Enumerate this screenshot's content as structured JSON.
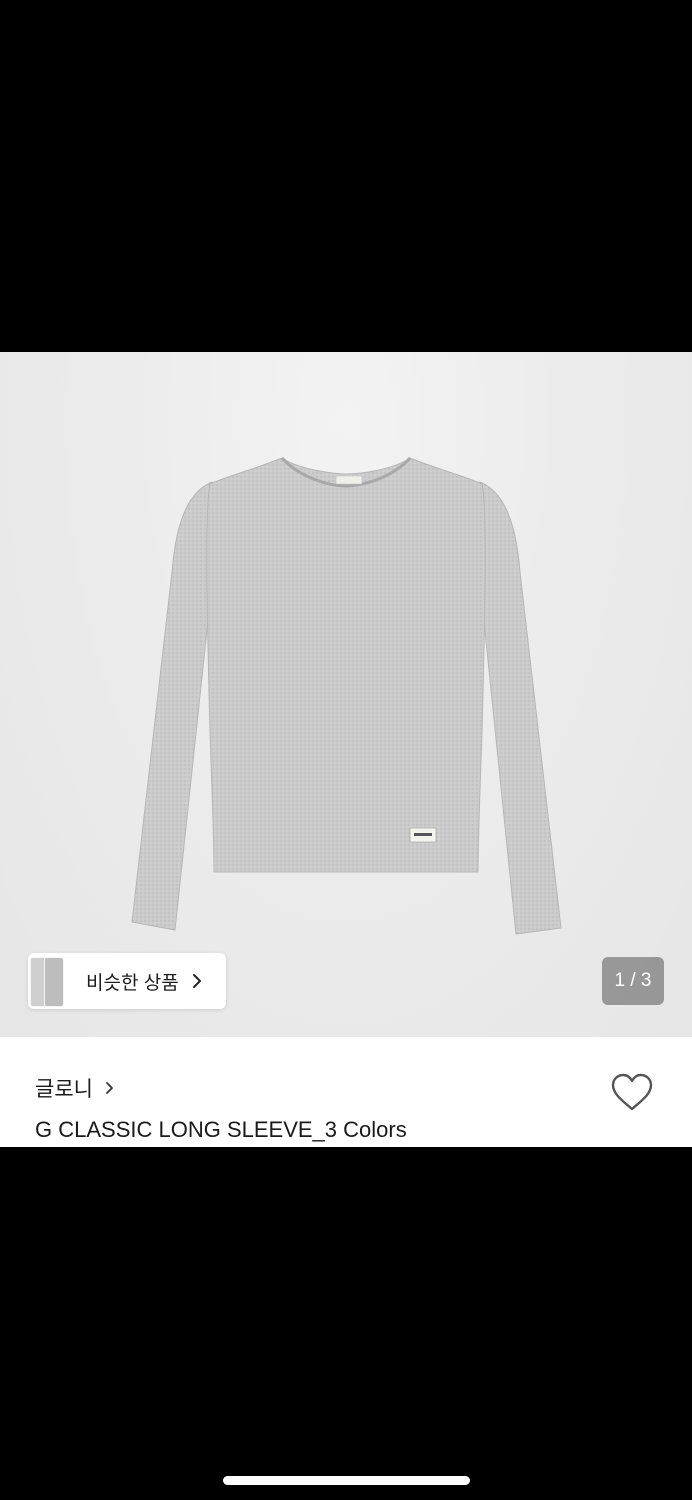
{
  "image_gallery": {
    "alt": "G CLASSIC LONG SLEEVE_3 Colors",
    "pager": "1 / 3",
    "similar_products_label": "비슷한 상품"
  },
  "product": {
    "brand": "글로니",
    "name": "G CLASSIC LONG SLEEVE_3 Colors"
  },
  "colors": {
    "background_dark": "#000000",
    "image_bg": "#ececec",
    "shirt": "#cfcfcf",
    "text": "#1a1a1a",
    "pager_bg": "#7a7a7a"
  },
  "icons": {
    "similar_chevron": "chevron-right-icon",
    "brand_chevron": "chevron-right-icon",
    "wishlist": "heart-outline-icon"
  }
}
